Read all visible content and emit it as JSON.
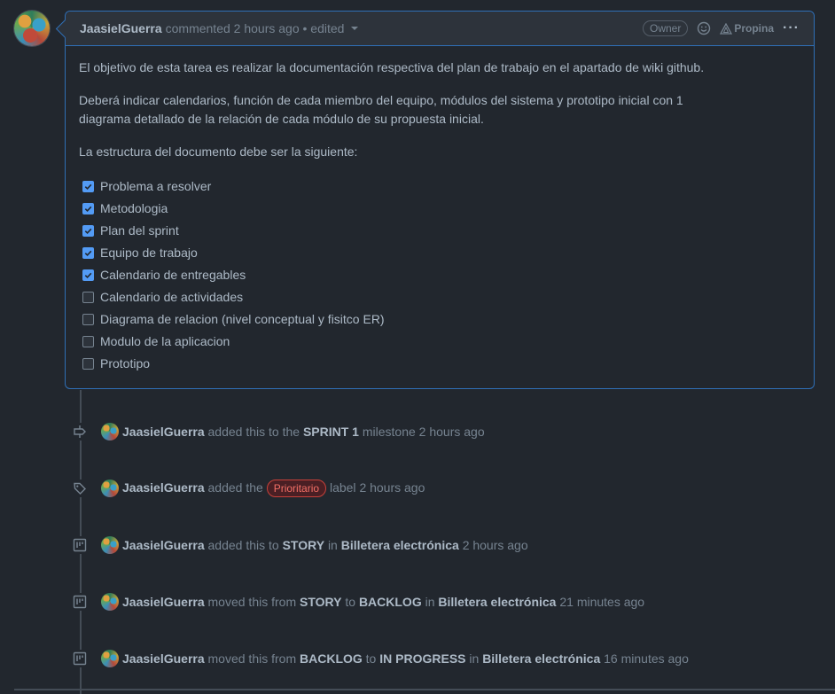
{
  "comment": {
    "author": "JaasielGuerra",
    "meta": "commented 2 hours ago • edited",
    "badge": "Owner",
    "tip_label": "Propina",
    "more": "···",
    "paragraph1": "El objetivo de esta tarea es realizar la documentación respectiva del plan de trabajo en el apartado de wiki github.",
    "paragraph2_line1": "Deberá indicar calendarios, función de cada miembro del equipo, módulos del sistema y prototipo inicial con 1",
    "paragraph2_line2": "diagrama detallado de la relación de cada módulo de su propuesta inicial.",
    "paragraph3": "La estructura del documento debe ser la siguiente:",
    "tasks": [
      {
        "label": "Problema a resolver",
        "checked": true
      },
      {
        "label": "Metodologia",
        "checked": true
      },
      {
        "label": "Plan del sprint",
        "checked": true
      },
      {
        "label": "Equipo de trabajo",
        "checked": true
      },
      {
        "label": "Calendario de entregables",
        "checked": true
      },
      {
        "label": "Calendario de actividades",
        "checked": false
      },
      {
        "label": "Diagrama de relacion (nivel conceptual y fisitco ER)",
        "checked": false
      },
      {
        "label": "Modulo de la aplicacion",
        "checked": false
      },
      {
        "label": "Prototipo",
        "checked": false
      }
    ]
  },
  "events": [
    {
      "icon": "milestone-icon",
      "user": "JaasielGuerra",
      "t1": "added this to the",
      "b1": "SPRINT 1",
      "t2": "milestone",
      "time": "2 hours ago"
    },
    {
      "icon": "tag-icon",
      "user": "JaasielGuerra",
      "t1": "added the",
      "label": "Prioritario",
      "t2": "label",
      "time": "2 hours ago"
    },
    {
      "icon": "project-icon",
      "user": "JaasielGuerra",
      "t1": "added this to",
      "b1": "STORY",
      "t2": "in",
      "b2": "Billetera electrónica",
      "time": "2 hours ago"
    },
    {
      "icon": "project-icon",
      "user": "JaasielGuerra",
      "t1": "moved this from",
      "b1": "STORY",
      "t2": "to",
      "b2": "BACKLOG",
      "t3": "in",
      "b3": "Billetera electrónica",
      "time": "21 minutes ago"
    },
    {
      "icon": "project-icon",
      "user": "JaasielGuerra",
      "t1": "moved this from",
      "b1": "BACKLOG",
      "t2": "to",
      "b2": "IN PROGRESS",
      "t3": "in",
      "b3": "Billetera electrónica",
      "time": "16 minutes ago"
    }
  ],
  "colors": {
    "bg": "#22272e",
    "accent_border": "#2f6fb6",
    "checkbox": "#539bf5",
    "label_red": "#f47067"
  }
}
